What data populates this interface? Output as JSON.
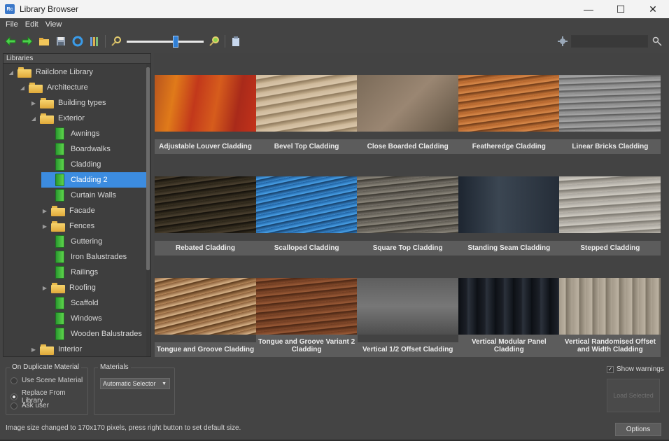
{
  "window": {
    "title": "Library Browser",
    "app_icon": "Rc",
    "minimize": "—",
    "maximize": "☐",
    "close": "✕"
  },
  "menu": {
    "items": [
      "File",
      "Edit",
      "View"
    ]
  },
  "toolbar": {
    "icons": [
      "back-arrow-icon",
      "forward-arrow-icon",
      "open-folder-icon",
      "save-icon",
      "refresh-icon",
      "library-icon",
      "zoom-out-icon",
      "zoom-in-icon",
      "clipboard-icon"
    ],
    "zoom_level": 0.64,
    "search_value": ""
  },
  "tree": {
    "header": "Libraries",
    "nodes": [
      {
        "label": "Railclone Library",
        "level": 0,
        "type": "folder",
        "expanded": true
      },
      {
        "label": "Architecture",
        "level": 1,
        "type": "folder",
        "expanded": true
      },
      {
        "label": "Building types",
        "level": 2,
        "type": "folder",
        "expanded": false
      },
      {
        "label": "Exterior",
        "level": 2,
        "type": "folder",
        "expanded": true
      },
      {
        "label": "Awnings",
        "level": 3,
        "type": "book"
      },
      {
        "label": "Boardwalks",
        "level": 3,
        "type": "book"
      },
      {
        "label": "Cladding",
        "level": 3,
        "type": "book"
      },
      {
        "label": "Cladding 2",
        "level": 3,
        "type": "book",
        "selected": true
      },
      {
        "label": "Curtain Walls",
        "level": 3,
        "type": "book"
      },
      {
        "label": "Facade",
        "level": 3,
        "type": "folder",
        "expanded": false
      },
      {
        "label": "Fences",
        "level": 3,
        "type": "folder",
        "expanded": false
      },
      {
        "label": "Guttering",
        "level": 3,
        "type": "book"
      },
      {
        "label": "Iron Balustrades",
        "level": 3,
        "type": "book"
      },
      {
        "label": "Railings",
        "level": 3,
        "type": "book"
      },
      {
        "label": "Roofing",
        "level": 3,
        "type": "folder",
        "expanded": false
      },
      {
        "label": "Scaffold",
        "level": 3,
        "type": "book"
      },
      {
        "label": "Windows",
        "level": 3,
        "type": "book"
      },
      {
        "label": "Wooden Balustrades",
        "level": 3,
        "type": "book"
      },
      {
        "label": "Interior",
        "level": 2,
        "type": "folder",
        "expanded": false
      }
    ]
  },
  "grid": {
    "items": [
      {
        "label": "Adjustable Louver Cladding",
        "bg": "linear-gradient(100deg,#b8541d 0%,#e07a1a 20%,#c2381b 40%,#d65c1c 60%,#a92a1a 80%,#c3321a 100%)"
      },
      {
        "label": "Bevel Top Cladding",
        "bg": "repeating-linear-gradient(170deg,#cdb89a 0px,#d9c6aa 6px,#8f7a5d 7px,#c8b291 13px)"
      },
      {
        "label": "Close Boarded Cladding",
        "bg": "linear-gradient(135deg,#7a6a58,#9a8672 50%,#5f5242)"
      },
      {
        "label": "Featheredge Cladding",
        "bg": "repeating-linear-gradient(172deg,#b3642c 0px,#d98a4a 5px,#6e3a18 6px,#c67538 11px)"
      },
      {
        "label": "Linear Bricks Cladding",
        "bg": "repeating-linear-gradient(178deg,#8c8c8c 0px,#a8a8a8 4px,#5a5a5a 5px,#999 9px)"
      },
      {
        "label": "Rebated Cladding",
        "bg": "repeating-linear-gradient(172deg,#2a2418 0px,#4c4130 5px,#120f0a 6px,#3a3222 11px)"
      },
      {
        "label": "Scalloped Cladding",
        "bg": "repeating-linear-gradient(168deg,#1f5f9e 0px,#4aa3ea 5px,#153e68 6px,#3a8ad0 11px)"
      },
      {
        "label": "Square Top Cladding",
        "bg": "repeating-linear-gradient(174deg,#5e5a52 0px,#8c877c 5px,#3a3730 6px,#77726a 11px)"
      },
      {
        "label": "Standing Seam Cladding",
        "bg": "linear-gradient(90deg,#1d2530,#3b4652 40%,#252d38 100%)"
      },
      {
        "label": "Stepped Cladding",
        "bg": "repeating-linear-gradient(176deg,#a9a59e 0px,#cfcbc2 6px,#7c7870 7px,#bbb6ad 13px)"
      },
      {
        "label": "Tongue and Groove Cladding",
        "bg": "repeating-linear-gradient(166deg,#8a5e38 0px,#d8b48a 6px,#5c3a1c 7px,#b88a5c 13px)"
      },
      {
        "label": "Tongue and Groove Variant 2 Cladding",
        "bg": "repeating-linear-gradient(174deg,#6e3c22 0px,#9a5a36 5px,#4a2614 6px,#844a2a 11px)"
      },
      {
        "label": "Vertical 1/2 Offset Cladding",
        "bg": "linear-gradient(180deg,#5e5e5e,#777 50%,#4e4e4e)"
      },
      {
        "label": "Vertical Modular Panel Cladding",
        "bg": "repeating-linear-gradient(90deg,#0c0f14 0px,#1c2028 12px,#2c323c 14px,#10141a 26px)"
      },
      {
        "label": "Vertical Randomised Offset and Width Cladding",
        "bg": "repeating-linear-gradient(90deg,#a49a8a 0px,#bcb2a2 9px,#7e7566 10px,#b0a696 19px)"
      }
    ]
  },
  "options": {
    "duplicate_title": "On Duplicate Material",
    "radios": [
      {
        "label": "Use Scene Material",
        "checked": false
      },
      {
        "label": "Replace From Library",
        "checked": true
      },
      {
        "label": "Ask user",
        "checked": false
      }
    ],
    "materials_title": "Materials",
    "materials_value": "Automatic Selector",
    "show_warnings_label": "Show warnings",
    "show_warnings_checked": true,
    "load_selected_label": "Load Selected",
    "options_label": "Options"
  },
  "status": {
    "message": "Image size changed to 170x170 pixels, press right button to set default size."
  }
}
